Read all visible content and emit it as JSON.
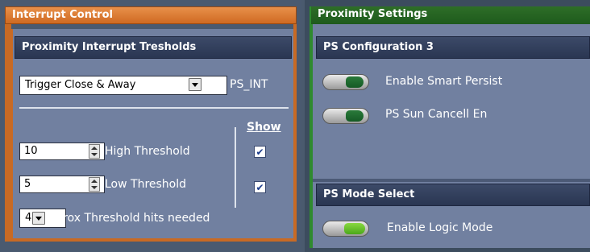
{
  "interrupt_control": {
    "title": "Interrupt Control",
    "thresholds_header": "Proximity Interrupt Tresholds",
    "mode_select_value": "Trigger Close & Away",
    "ps_int_label": "PS_INT",
    "show_label": "Show",
    "high_threshold": {
      "value": "10",
      "label": "High Threshold",
      "show_checked": true
    },
    "low_threshold": {
      "value": "5",
      "label": "Low Threshold",
      "show_checked": true
    },
    "hits_select_value": "4",
    "hits_label": "Prox Threshold hits needed"
  },
  "proximity_settings": {
    "title": "Proximity  Settings",
    "config3_header": "PS Configuration 3",
    "enable_smart_persist": {
      "label": "Enable Smart Persist",
      "state": "on-dark"
    },
    "sun_cancel": {
      "label": "PS Sun Cancell En",
      "state": "on-dark"
    },
    "mode_select_header": "PS Mode Select",
    "enable_logic_mode": {
      "label": "Enable Logic Mode",
      "state": "on-light"
    }
  },
  "colors": {
    "left_accent": "#c86a24",
    "right_accent": "#1e5a1c",
    "panel_bg": "#7180a0",
    "header_bg": "#2a3652"
  },
  "icons": {
    "dropdown": "chevron-down-icon",
    "spinner": "spinner-icon",
    "checkbox": "check-icon",
    "toggle": "toggle-switch-icon"
  }
}
